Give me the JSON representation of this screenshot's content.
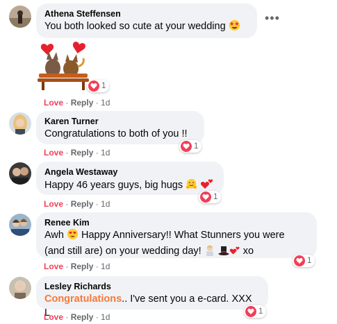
{
  "comments": [
    {
      "author": "Athena Steffensen",
      "text": "You both looked so cute at your wedding",
      "reaction_count": "1",
      "actions": {
        "love": "Love",
        "reply": "Reply",
        "time": "1d"
      }
    },
    {
      "author": "Karen Turner",
      "text": "Congratulations to both of you !!",
      "reaction_count": "1",
      "actions": {
        "love": "Love",
        "reply": "Reply",
        "time": "1d"
      }
    },
    {
      "author": "Angela Westaway",
      "text": "Happy 46 years guys, big hugs",
      "reaction_count": "1",
      "actions": {
        "love": "Love",
        "reply": "Reply",
        "time": "1d"
      }
    },
    {
      "author": "Renee Kim",
      "text_line1_a": "Awh",
      "text_line1_b": "Happy Anniversary!! What Stunners you were",
      "text_line2_a": "(and still are) on your wedding day!",
      "text_line2_b": "xo",
      "reaction_count": "1",
      "actions": {
        "love": "Love",
        "reply": "Reply",
        "time": "1d"
      }
    },
    {
      "author": "Lesley Richards",
      "highlight": "Congratulations",
      "text": ".. I've sent you a e-card. XXX L",
      "reaction_count": "1",
      "actions": {
        "love": "Love",
        "reply": "Reply",
        "time": "1d"
      }
    }
  ],
  "sticker_reaction_count": "1",
  "separator": " · ",
  "colors": {
    "love": "#f33e58",
    "meta": "#65676b",
    "bubble": "#f0f2f5",
    "highlight": "#f5793b"
  },
  "icons": [
    "more-options-icon",
    "heart-icon",
    "star-struck-emoji",
    "hug-emoji",
    "two-hearts-emoji",
    "heart-eyes-emoji",
    "groom-emoji",
    "top-hat-emoji",
    "love-sticker"
  ]
}
